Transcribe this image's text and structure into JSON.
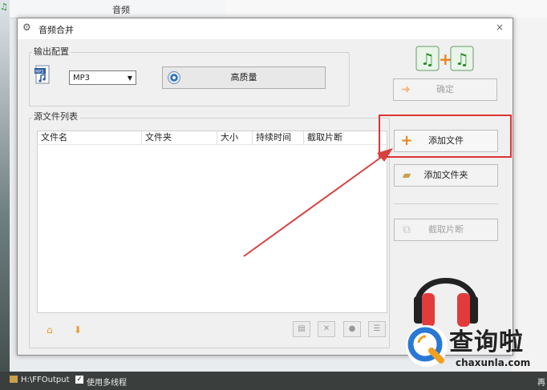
{
  "background": {
    "tab_title": "音频",
    "app_icon": "music-note-icon"
  },
  "dialog": {
    "title": "音频合并",
    "title_icon": "audio-tool-icon",
    "close_icon": "close-icon",
    "close_label": "×"
  },
  "output_config": {
    "label": "输出配置",
    "format_icon": "mp3-file-icon",
    "format_value": "MP3",
    "quality_label": "高质量",
    "quality_icon": "quality-dial-icon"
  },
  "source_list": {
    "label": "源文件列表",
    "columns": [
      "文件名",
      "文件夹",
      "大小",
      "持续时间",
      "截取片断"
    ],
    "rows": [],
    "bottom_icons": [
      "move-up-icon",
      "move-down-icon",
      "open-file-icon",
      "remove-icon",
      "play-icon",
      "info-icon"
    ]
  },
  "actions": {
    "merge_logo_icon": "merge-music-icon",
    "confirm_label": "确定",
    "confirm_icon": "confirm-arrow-icon",
    "add_file_label": "添加文件",
    "add_file_icon": "plus-icon",
    "add_folder_label": "添加文件夹",
    "add_folder_icon": "add-folder-icon",
    "clip_label": "截取片断",
    "clip_icon": "clip-icon"
  },
  "status_bar": {
    "path": "H:\\FFOutput",
    "multithread_label": "使用多线程",
    "multithread_checked": true,
    "right_text": "再"
  },
  "watermark": {
    "title": "查询啦",
    "subtitle": "chaxunla.com"
  },
  "colors": {
    "highlight": "#dd3333",
    "arrow": "#d84040",
    "plus_orange": "#e8851a",
    "headphone_red": "#e23b3b"
  }
}
